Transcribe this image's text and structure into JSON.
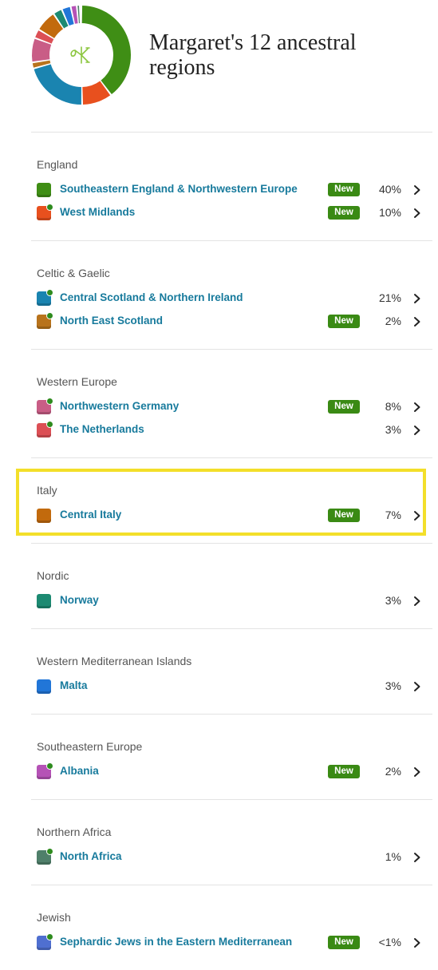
{
  "title": "Margaret's 12 ancestral regions",
  "brand": {
    "accent": "#177a9c",
    "new_badge_color": "#3a8a14",
    "new_dot_color": "#2e8b1e",
    "highlight_color": "#f3df2a",
    "logo_icon": "ancestry-leaf-icon"
  },
  "new_badge_label": "New",
  "groups": [
    {
      "name": "England",
      "regions": [
        {
          "name": "Southeastern England & Northwestern Europe",
          "percent": "40%",
          "value": 40,
          "is_new": true,
          "new_dot": false,
          "color": "#3f8e15"
        },
        {
          "name": "West Midlands",
          "percent": "10%",
          "value": 10,
          "is_new": true,
          "new_dot": true,
          "color": "#e8501e"
        }
      ]
    },
    {
      "name": "Celtic & Gaelic",
      "regions": [
        {
          "name": "Central Scotland & Northern Ireland",
          "percent": "21%",
          "value": 21,
          "is_new": false,
          "new_dot": true,
          "color": "#1a84b0"
        },
        {
          "name": "North East Scotland",
          "percent": "2%",
          "value": 2,
          "is_new": true,
          "new_dot": true,
          "color": "#b8731c"
        }
      ]
    },
    {
      "name": "Western Europe",
      "regions": [
        {
          "name": "Northwestern Germany",
          "percent": "8%",
          "value": 8,
          "is_new": true,
          "new_dot": true,
          "color": "#c95d86"
        },
        {
          "name": "The Netherlands",
          "percent": "3%",
          "value": 3,
          "is_new": false,
          "new_dot": true,
          "color": "#dc4f55"
        }
      ]
    },
    {
      "name": "Italy",
      "highlighted": true,
      "regions": [
        {
          "name": "Central Italy",
          "percent": "7%",
          "value": 7,
          "is_new": true,
          "new_dot": false,
          "color": "#c26a0d"
        }
      ]
    },
    {
      "name": "Nordic",
      "regions": [
        {
          "name": "Norway",
          "percent": "3%",
          "value": 3,
          "is_new": false,
          "new_dot": false,
          "color": "#1c8a72"
        }
      ]
    },
    {
      "name": "Western Mediterranean Islands",
      "regions": [
        {
          "name": "Malta",
          "percent": "3%",
          "value": 3,
          "is_new": false,
          "new_dot": false,
          "color": "#2176d8"
        }
      ]
    },
    {
      "name": "Southeastern Europe",
      "regions": [
        {
          "name": "Albania",
          "percent": "2%",
          "value": 2,
          "is_new": true,
          "new_dot": true,
          "color": "#b552b6"
        }
      ]
    },
    {
      "name": "Northern Africa",
      "regions": [
        {
          "name": "North Africa",
          "percent": "1%",
          "value": 1,
          "is_new": false,
          "new_dot": true,
          "color": "#4f7f6a"
        }
      ]
    },
    {
      "name": "Jewish",
      "regions": [
        {
          "name": "Sephardic Jews in the Eastern Mediterranean",
          "percent": "<1%",
          "value": 0.5,
          "is_new": true,
          "new_dot": true,
          "color": "#4f6fd0"
        }
      ]
    }
  ]
}
